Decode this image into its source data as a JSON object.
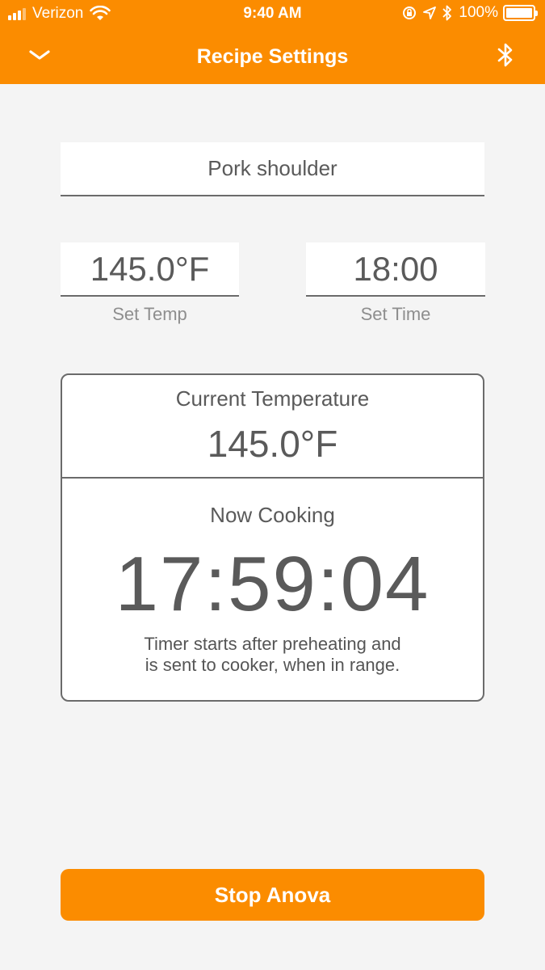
{
  "status_bar": {
    "carrier": "Verizon",
    "time": "9:40 AM",
    "battery": "100%",
    "icons": [
      "signal-icon",
      "wifi-icon",
      "rotation-lock-icon",
      "location-icon",
      "bluetooth-icon",
      "battery-icon"
    ]
  },
  "nav": {
    "title": "Recipe Settings",
    "back_icon": "chevron-down-icon",
    "bluetooth_icon": "bluetooth-icon"
  },
  "recipe": {
    "name": "Pork shoulder"
  },
  "settings": {
    "temp_value": "145.0°F",
    "temp_label": "Set Temp",
    "time_value": "18:00",
    "time_label": "Set Time"
  },
  "status": {
    "current_label": "Current Temperature",
    "current_value": "145.0°F",
    "cooking_label": "Now Cooking",
    "countdown": "17:59:04",
    "note_line1": "Timer starts after preheating and",
    "note_line2": "is sent to cooker, when in range."
  },
  "actions": {
    "stop_label": "Stop Anova"
  },
  "colors": {
    "accent": "#fb8c00",
    "background": "#f4f4f4",
    "text": "#5a5a5a"
  }
}
